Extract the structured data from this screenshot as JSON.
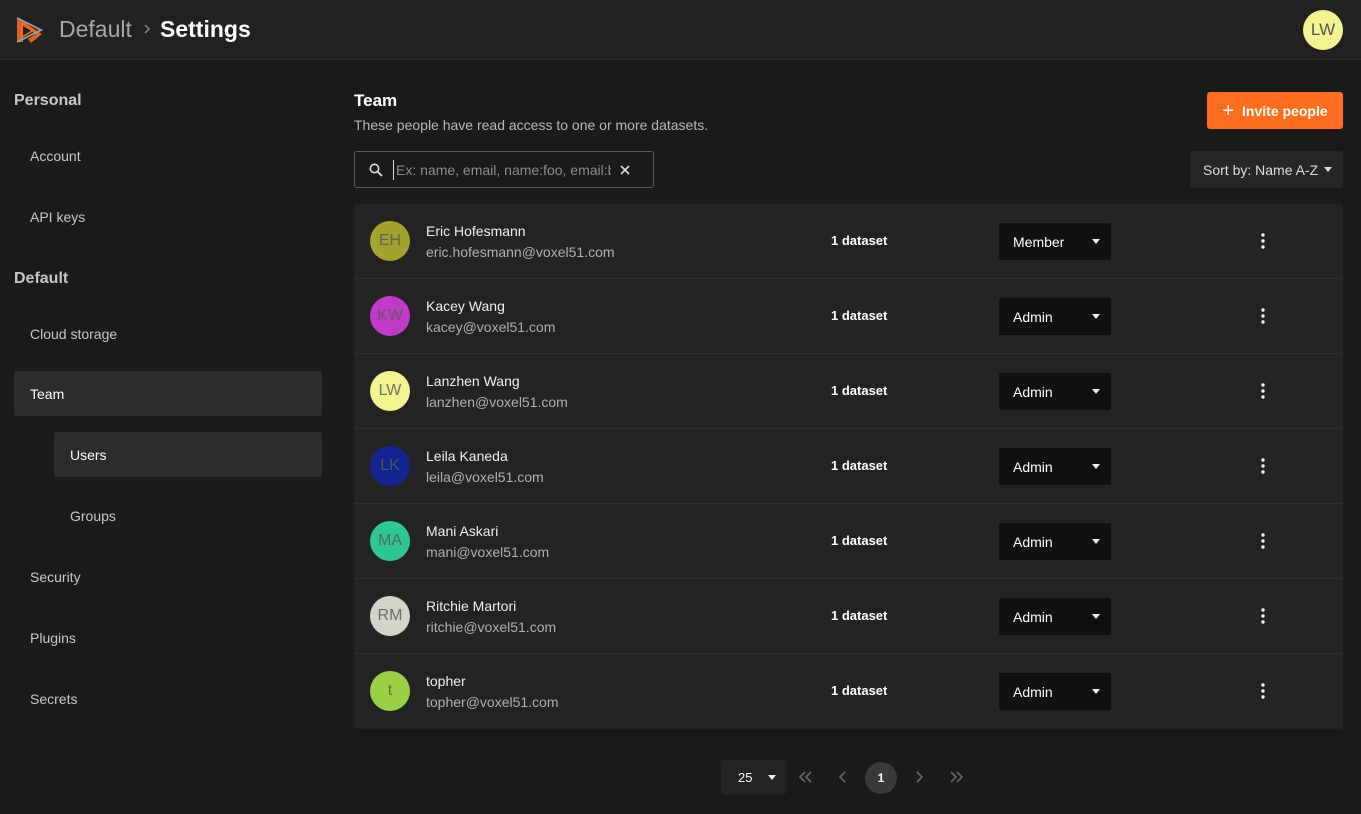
{
  "header": {
    "breadcrumb_workspace": "Default",
    "breadcrumb_page": "Settings",
    "user_initials": "LW",
    "logo_icon": "voxel51-logo"
  },
  "sidebar": {
    "section_personal": "Personal",
    "account": "Account",
    "api_keys": "API keys",
    "section_default": "Default",
    "cloud_storage": "Cloud storage",
    "team": "Team",
    "users": "Users",
    "groups": "Groups",
    "security": "Security",
    "plugins": "Plugins",
    "secrets": "Secrets",
    "active_item": "Users"
  },
  "main": {
    "title": "Team",
    "description": "These people have read access to one or more datasets.",
    "invite_button": "Invite people",
    "search_placeholder": "Ex: name, email, name:foo, email:bar",
    "sort_label": "Sort by: Name A-Z"
  },
  "users": [
    {
      "initials": "EH",
      "name": "Eric Hofesmann",
      "email": "eric.hofesmann@voxel51.com",
      "datasets": "1 dataset",
      "role": "Member",
      "color": "#a3a32e"
    },
    {
      "initials": "KW",
      "name": "Kacey Wang",
      "email": "kacey@voxel51.com",
      "datasets": "1 dataset",
      "role": "Admin",
      "color": "#c03ac7"
    },
    {
      "initials": "LW",
      "name": "Lanzhen Wang",
      "email": "lanzhen@voxel51.com",
      "datasets": "1 dataset",
      "role": "Admin",
      "color": "#f3f38f"
    },
    {
      "initials": "LK",
      "name": "Leila Kaneda",
      "email": "leila@voxel51.com",
      "datasets": "1 dataset",
      "role": "Admin",
      "color": "#13238f"
    },
    {
      "initials": "MA",
      "name": "Mani Askari",
      "email": "mani@voxel51.com",
      "datasets": "1 dataset",
      "role": "Admin",
      "color": "#2fc794"
    },
    {
      "initials": "RM",
      "name": "Ritchie Martori",
      "email": "ritchie@voxel51.com",
      "datasets": "1 dataset",
      "role": "Admin",
      "color": "#d3d3c7"
    },
    {
      "initials": "t",
      "name": "topher",
      "email": "topher@voxel51.com",
      "datasets": "1 dataset",
      "role": "Admin",
      "color": "#9ad142"
    }
  ],
  "pagination": {
    "page_size": "25",
    "current_page": "1"
  },
  "colors": {
    "accent": "#ff6d1f",
    "background": "#1a1a1a",
    "panel": "#232323"
  }
}
